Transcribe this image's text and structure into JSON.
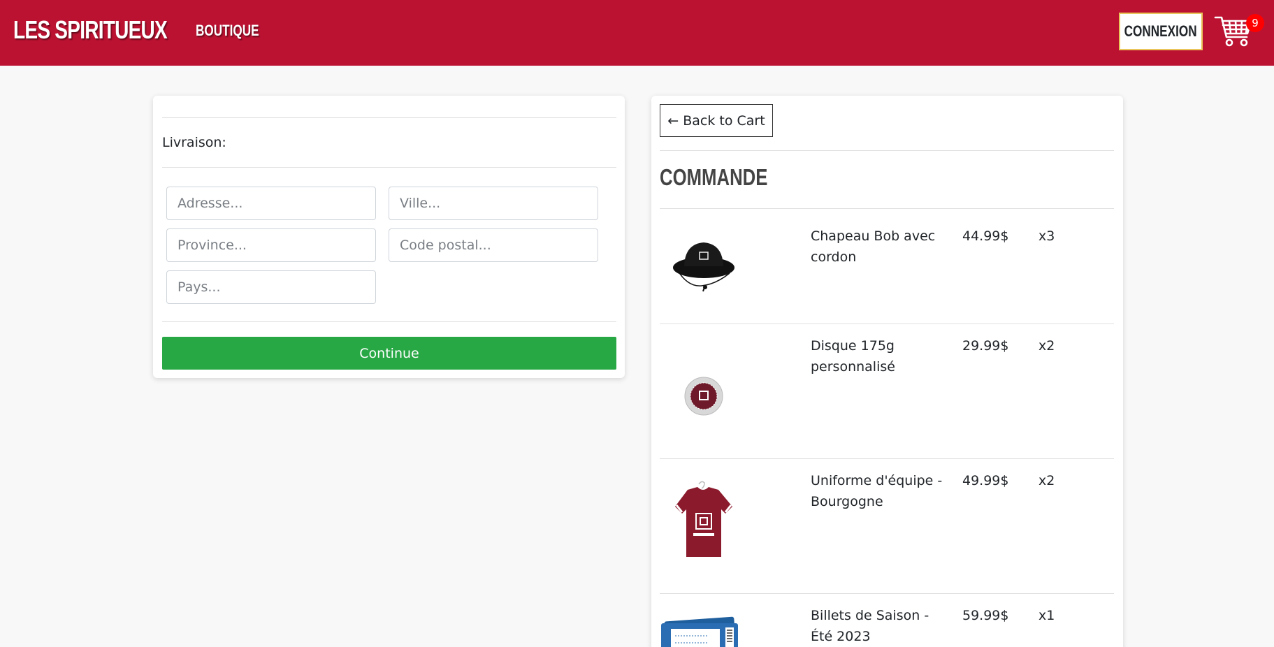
{
  "navbar": {
    "brand": "LES SPIRITUEUX",
    "nav_link": "BOUTIQUE",
    "login_label": "CONNEXION",
    "cart_count": "9",
    "bg_color": "#bc1232"
  },
  "shipping": {
    "title": "Livraison:",
    "fields": {
      "address_placeholder": "Adresse...",
      "city_placeholder": "Ville...",
      "province_placeholder": "Province...",
      "postal_placeholder": "Code postal...",
      "country_placeholder": "Pays..."
    },
    "continue_label": "Continue",
    "continue_color": "#28a745"
  },
  "order": {
    "back_label": "← Back to Cart",
    "title": "COMMANDE",
    "items": [
      {
        "name": "Chapeau Bob avec cordon",
        "price": "44.99$",
        "qty": "x3",
        "icon": "bucket-hat-image"
      },
      {
        "name": "Disque 175g personnalisé",
        "price": "29.99$",
        "qty": "x2",
        "icon": "frisbee-disc-image"
      },
      {
        "name": "Uniforme d'équipe - Bourgogne",
        "price": "49.99$",
        "qty": "x2",
        "icon": "burgundy-jersey-image"
      },
      {
        "name": "Billets de Saison - Été 2023",
        "price": "59.99$",
        "qty": "x1",
        "icon": "season-tickets-image"
      }
    ]
  }
}
